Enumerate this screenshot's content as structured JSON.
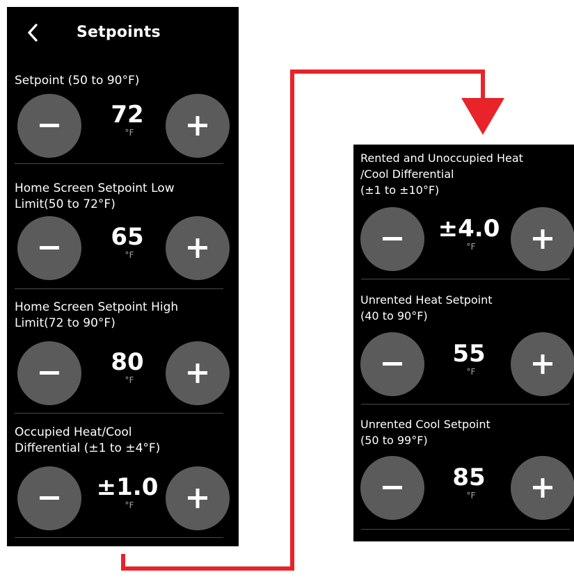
{
  "colors": {
    "panel_background": "#000000",
    "button_fill": "#5b5b5b",
    "connector_red": "#e8232a",
    "unit_gray": "#a6a6a6"
  },
  "header": {
    "title": "Setpoints",
    "back_icon": "chevron-left-icon"
  },
  "left_settings": [
    {
      "label_lines": [
        "Setpoint (50 to 90°F)"
      ],
      "value": "72",
      "unit": "°F"
    },
    {
      "label_lines": [
        "Home Screen Setpoint Low",
        "Limit(50 to 72°F)"
      ],
      "value": "65",
      "unit": "°F"
    },
    {
      "label_lines": [
        "Home Screen Setpoint High",
        "Limit(72 to 90°F)"
      ],
      "value": "80",
      "unit": "°F"
    },
    {
      "label_lines": [
        "Occupied Heat/Cool",
        "Differential (±1 to ±4°F)"
      ],
      "value": "±1.0",
      "unit": "°F"
    }
  ],
  "right_settings": [
    {
      "label_lines": [
        "Rented and Unoccupied Heat",
        "/Cool Differential",
        "(±1 to ±10°F)"
      ],
      "value": "±4.0",
      "unit": "°F"
    },
    {
      "label_lines": [
        "Unrented Heat Setpoint",
        "(40 to 90°F)"
      ],
      "value": "55",
      "unit": "°F"
    },
    {
      "label_lines": [
        "Unrented Cool Setpoint",
        "(50 to 99°F)"
      ],
      "value": "85",
      "unit": "°F"
    }
  ],
  "icons": {
    "decrease": "minus-icon",
    "increase": "plus-icon",
    "connector_arrow": "arrow-down-icon"
  }
}
